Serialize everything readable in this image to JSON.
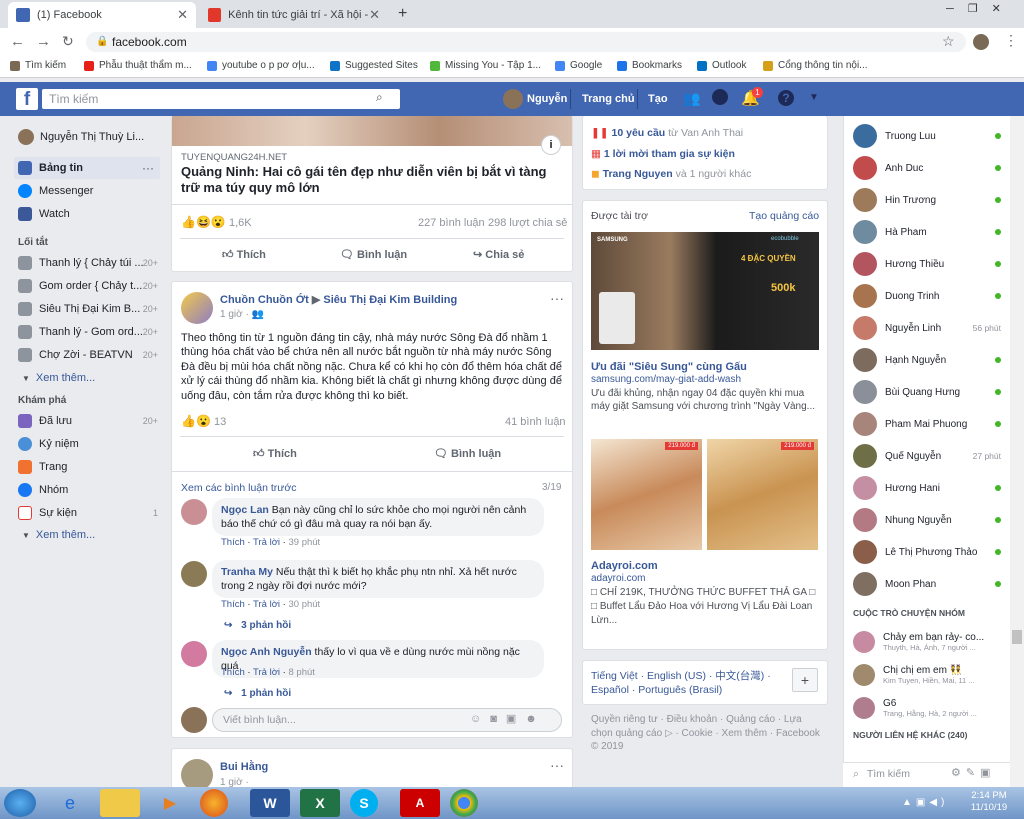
{
  "browser": {
    "tabs": [
      {
        "title": "(1) Facebook"
      },
      {
        "title": "Kênh tin tức giải trí - Xã hội - Ken"
      }
    ],
    "url": "facebook.com",
    "bookmarks": [
      "Tìm kiếm",
      "Phẫu thuật thẩm m...",
      "youtube o p pơ ơļu...",
      "Suggested Sites",
      "Missing You - Tập 1...",
      "Google",
      "Bookmarks",
      "Outlook",
      "Cổng thông tin nội..."
    ]
  },
  "header": {
    "search_placeholder": "Tìm kiếm",
    "user": "Nguyễn",
    "home": "Trang chủ",
    "create": "Tạo",
    "notif_count": "1"
  },
  "left_nav": {
    "profile": "Nguyễn Thị Thuỳ Li...",
    "main": [
      {
        "label": "Bảng tin"
      },
      {
        "label": "Messenger"
      },
      {
        "label": "Watch"
      }
    ],
    "shortcuts_title": "Lối tắt",
    "shortcuts": [
      {
        "label": "Thanh lý { Chảy túi ...",
        "count": "20+"
      },
      {
        "label": "Gom order { Chảy t...",
        "count": "20+"
      },
      {
        "label": "Siêu Thị Đại Kim B...",
        "count": "20+"
      },
      {
        "label": "Thanh lý - Gom ord...",
        "count": "20+"
      },
      {
        "label": "Chợ Zời - BEATVN",
        "count": "20+"
      }
    ],
    "see_more": "Xem thêm...",
    "explore_title": "Khám phá",
    "explore": [
      {
        "label": "Đã lưu",
        "count": "20+"
      },
      {
        "label": "Kỷ niệm",
        "count": ""
      },
      {
        "label": "Trang",
        "count": ""
      },
      {
        "label": "Nhóm",
        "count": ""
      },
      {
        "label": "Sự kiện",
        "count": "1"
      }
    ],
    "see_more2": "Xem thêm..."
  },
  "post1": {
    "source": "TUYENQUANG24H.NET",
    "title": "Quảng Ninh: Hai cô gái tên đẹp như diễn viên bị bắt vì tàng trữ ma túy quy mô lớn",
    "reactions": "1,6K",
    "comments": "227 bình luận",
    "shares": "298 lượt chia sẻ",
    "like": "Thích",
    "comment": "Bình luận",
    "share": "Chia sẻ"
  },
  "post2": {
    "author": "Chuồn Chuồn Ớt",
    "group": "Siêu Thị Đại Kim Building",
    "time": "1 giờ ·",
    "text": "Theo thông tin từ 1 nguồn đáng tin cậy, nhà máy nước Sông Đà đổ nhầm 1 thùng hóa chất vào bể chứa nên all nước bắt nguồn từ nhà máy nước Sông Đà đều bị mùi hóa chất nồng nặc. Chưa kể có khi họ còn đổ thêm hóa chất để xử lý cái thùng đổ nhầm kia. Không biết là chất gì nhưng không được dùng để uống đâu, còn tắm rửa được không thì ko biết.",
    "reactions": "13",
    "comments": "41 bình luận",
    "like": "Thích",
    "comment": "Bình luận",
    "prev_comments": "Xem các bình luận trước",
    "page_count": "3/19",
    "comment_list": [
      {
        "name": "Ngọc Lan",
        "text": "Bạn này cũng chỉ lo sức khỏe cho mọi người nên cảnh báo thế chứ có gì đâu mà quay ra nói bạn ấy.",
        "like": "Thích",
        "reply": "Trả lời",
        "time": "39 phút",
        "replies": ""
      },
      {
        "name": "Tranha My",
        "text": "Nếu thật thì k biết họ khắc phụ ntn nhỉ. Xả hết nước trong 2 ngày rồi đợi nước mới?",
        "like": "Thích",
        "reply": "Trả lời",
        "time": "30 phút",
        "replies": "3 phản hồi"
      },
      {
        "name": "Ngọc Anh Nguyễn",
        "text": "thấy lo vì qua về e dùng nước mùi nồng nặc quá",
        "like": "Thích",
        "reply": "Trả lời",
        "time": "8 phút",
        "replies": "1 phản hồi"
      }
    ],
    "write_placeholder": "Viết bình luận..."
  },
  "post3": {
    "author": "Bui Hằng",
    "time": "1 giờ ·"
  },
  "right_col": {
    "req_count": "10 yêu cầu",
    "req_from": "từ Van Anh Thai",
    "event": "1 lời mời tham gia sự kiện",
    "birthday_name": "Trang Nguyen",
    "birthday_rest": "và 1 người khác",
    "sponsored": "Được tài trợ",
    "create_ad": "Tạo quảng cáo",
    "ad1": {
      "title": "Ưu đãi \"Siêu Sung\" cùng Gấu",
      "url": "samsung.com/may-giat-add-wash",
      "desc": "Ưu đãi khủng, nhận ngay 04 đặc quyền khi mua máy giặt Samsung với chương trình \"Ngày Vàng...",
      "brand": "SAMSUNG",
      "badge": "ecobubble",
      "promo1": "4 ĐẶC QUYỀN",
      "promo2": "500k"
    },
    "ad2": {
      "title": "Adayroi.com",
      "url": "adayroi.com",
      "desc": "□ CHỈ 219K, THƯỞNG THỨC BUFFET THẢ GA □ □ Buffet Lẩu Đảo Hoa với Hương Vị Lẩu Đài Loan Lừn...",
      "price": "219.000 đ"
    },
    "languages": "Tiếng Việt · English (US) · 中文(台灣) · Español · Português (Brasil)",
    "footer": "Quyền riêng tư · Điều khoản · Quảng cáo · Lựa chọn quảng cáo ▷ · Cookie · Xem thêm · Facebook © 2019"
  },
  "chat": {
    "contacts": [
      {
        "name": "Truong Luu",
        "time": ""
      },
      {
        "name": "Anh Duc",
        "time": ""
      },
      {
        "name": "Hin Trương",
        "time": ""
      },
      {
        "name": "Hà Pham",
        "time": ""
      },
      {
        "name": "Hương Thiều",
        "time": ""
      },
      {
        "name": "Duong Trinh",
        "time": ""
      },
      {
        "name": "Nguyễn Linh",
        "time": "56 phút"
      },
      {
        "name": "Hạnh Nguyễn",
        "time": ""
      },
      {
        "name": "Bùi Quang Hưng",
        "time": ""
      },
      {
        "name": "Pham Mai Phuong",
        "time": ""
      },
      {
        "name": "Quế Nguyễn",
        "time": "27 phút"
      },
      {
        "name": "Hương Hani",
        "time": ""
      },
      {
        "name": "Nhung Nguyễn",
        "time": ""
      },
      {
        "name": "Lê Thị Phương Thảo",
        "time": ""
      },
      {
        "name": "Moon Phan",
        "time": ""
      }
    ],
    "groups_title": "CUỘC TRÒ CHUYỆN NHÓM",
    "groups": [
      {
        "name": "Chảy em bạn rảy- co...",
        "members": "Thuyth, Hà, Ánh, 7 người ..."
      },
      {
        "name": "Chị chị em em 👯",
        "members": "Kim Tuyen, Hiền, Mai, 11 ..."
      },
      {
        "name": "G6",
        "members": "Trang, Hằng, Hà, 2 người ..."
      }
    ],
    "others_title": "NGƯỜI LIÊN HỆ KHÁC (240)",
    "search": "Tìm kiếm"
  },
  "clock": {
    "time": "2:14 PM",
    "date": "11/10/19"
  }
}
